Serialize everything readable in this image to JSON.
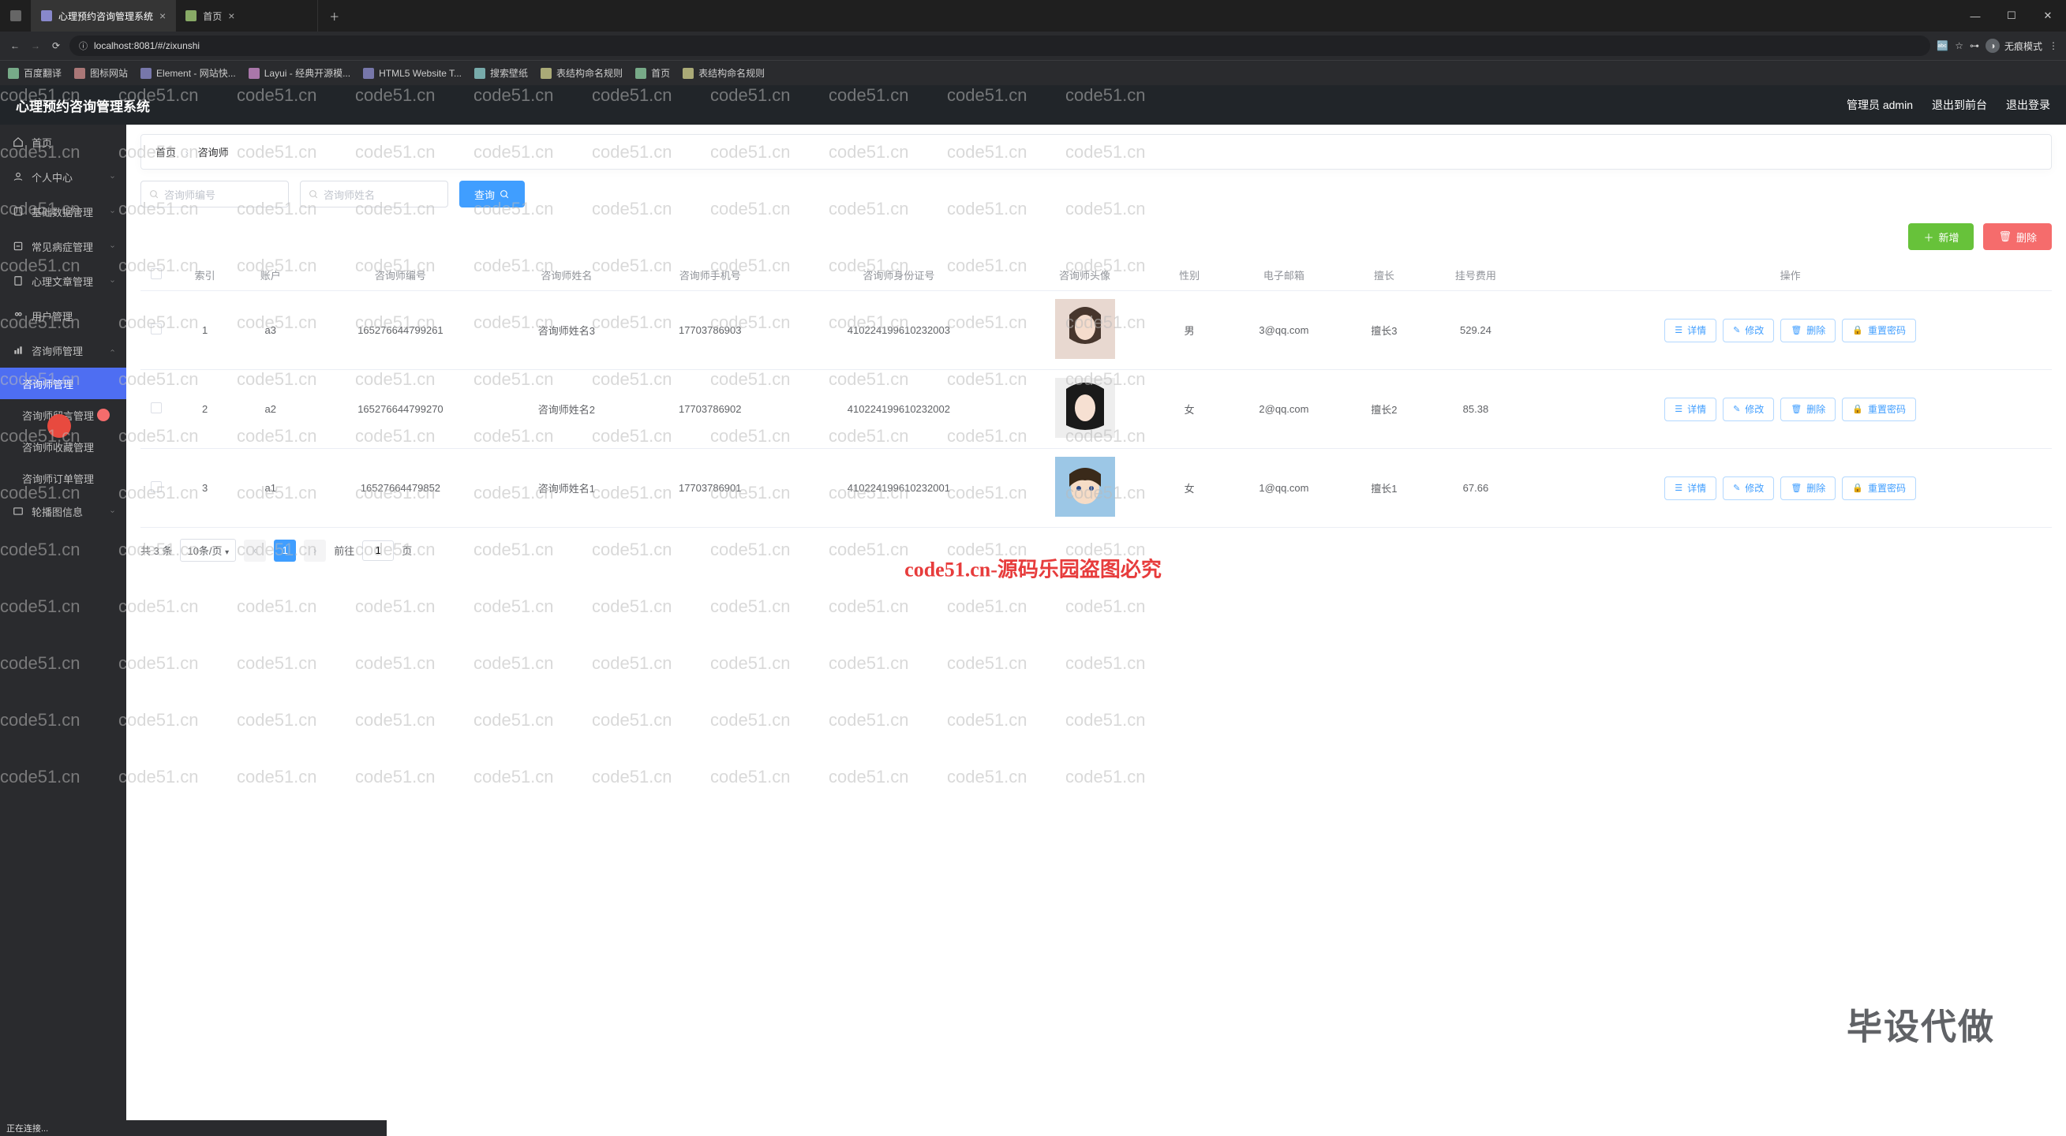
{
  "browser": {
    "tabs": [
      {
        "label": "心理预约咨询管理系统",
        "active": true
      },
      {
        "label": "首页",
        "active": false
      }
    ],
    "url": "localhost:8081/#/zixunshi",
    "profile": "无痕模式",
    "bookmarks": [
      "百度翻译",
      "图标网站",
      "Element - 网站快...",
      "Layui - 经典开源模...",
      "HTML5 Website T...",
      "搜索壁纸",
      "表结构命名规则",
      "首页",
      "表结构命名规则"
    ]
  },
  "header": {
    "title": "心理预约咨询管理系统",
    "user_label": "管理员 admin",
    "back_front": "退出到前台",
    "logout": "退出登录"
  },
  "sidebar": {
    "items": [
      {
        "label": "首页",
        "icon": "home-icon",
        "expand": false
      },
      {
        "label": "个人中心",
        "icon": "user-icon",
        "expand": true
      },
      {
        "label": "基础数据管理",
        "icon": "db-icon",
        "expand": true
      },
      {
        "label": "常见病症管理",
        "icon": "med-icon",
        "expand": true
      },
      {
        "label": "心理文章管理",
        "icon": "doc-icon",
        "expand": true
      },
      {
        "label": "用户管理",
        "icon": "users-icon",
        "expand": false
      },
      {
        "label": "咨询师管理",
        "icon": "chart-icon",
        "expand": true,
        "expanded": true
      }
    ],
    "subs": [
      {
        "label": "咨询师管理",
        "active": true
      },
      {
        "label": "咨询师留言管理",
        "active": false,
        "has_badge": true
      },
      {
        "label": "咨询师收藏管理",
        "active": false
      },
      {
        "label": "咨询师订单管理",
        "active": false
      }
    ],
    "trailing": [
      {
        "label": "轮播图信息",
        "icon": "img-icon",
        "expand": true
      }
    ]
  },
  "breadcrumb": {
    "a": "首页",
    "b": "咨询师"
  },
  "search": {
    "ph1": "咨询师编号",
    "ph2": "咨询师姓名",
    "btn": "查询"
  },
  "actions": {
    "add": "新增",
    "del": "删除"
  },
  "table": {
    "headers": [
      "索引",
      "账户",
      "咨询师编号",
      "咨询师姓名",
      "咨询师手机号",
      "咨询师身份证号",
      "咨询师头像",
      "性别",
      "电子邮箱",
      "擅长",
      "挂号费用",
      "操作"
    ],
    "op_labels": {
      "detail": "详情",
      "edit": "修改",
      "delete": "删除",
      "reset": "重置密码"
    },
    "rows": [
      {
        "idx": "1",
        "acct": "a3",
        "no": "165276644799261",
        "name": "咨询师姓名3",
        "phone": "17703786903",
        "idcard": "410224199610232003",
        "avatar": "f1",
        "gender": "男",
        "email": "3@qq.com",
        "good": "擅长3",
        "fee": "529.24"
      },
      {
        "idx": "2",
        "acct": "a2",
        "no": "165276644799270",
        "name": "咨询师姓名2",
        "phone": "17703786902",
        "idcard": "410224199610232002",
        "avatar": "f2",
        "gender": "女",
        "email": "2@qq.com",
        "good": "擅长2",
        "fee": "85.38"
      },
      {
        "idx": "3",
        "acct": "a1",
        "no": "16527664479852",
        "name": "咨询师姓名1",
        "phone": "17703786901",
        "idcard": "410224199610232001",
        "avatar": "m1",
        "gender": "女",
        "email": "1@qq.com",
        "good": "擅长1",
        "fee": "67.66"
      }
    ]
  },
  "pager": {
    "total": "共 3 条",
    "page_size": "10条/页",
    "current": "1",
    "jump_pre": "前往",
    "jump_val": "1",
    "jump_suf": "页"
  },
  "watermark": {
    "repeat": "code51.cn",
    "center": "code51.cn-源码乐园盗图必究",
    "corner": "毕设代做"
  },
  "statusbar": "正在连接..."
}
